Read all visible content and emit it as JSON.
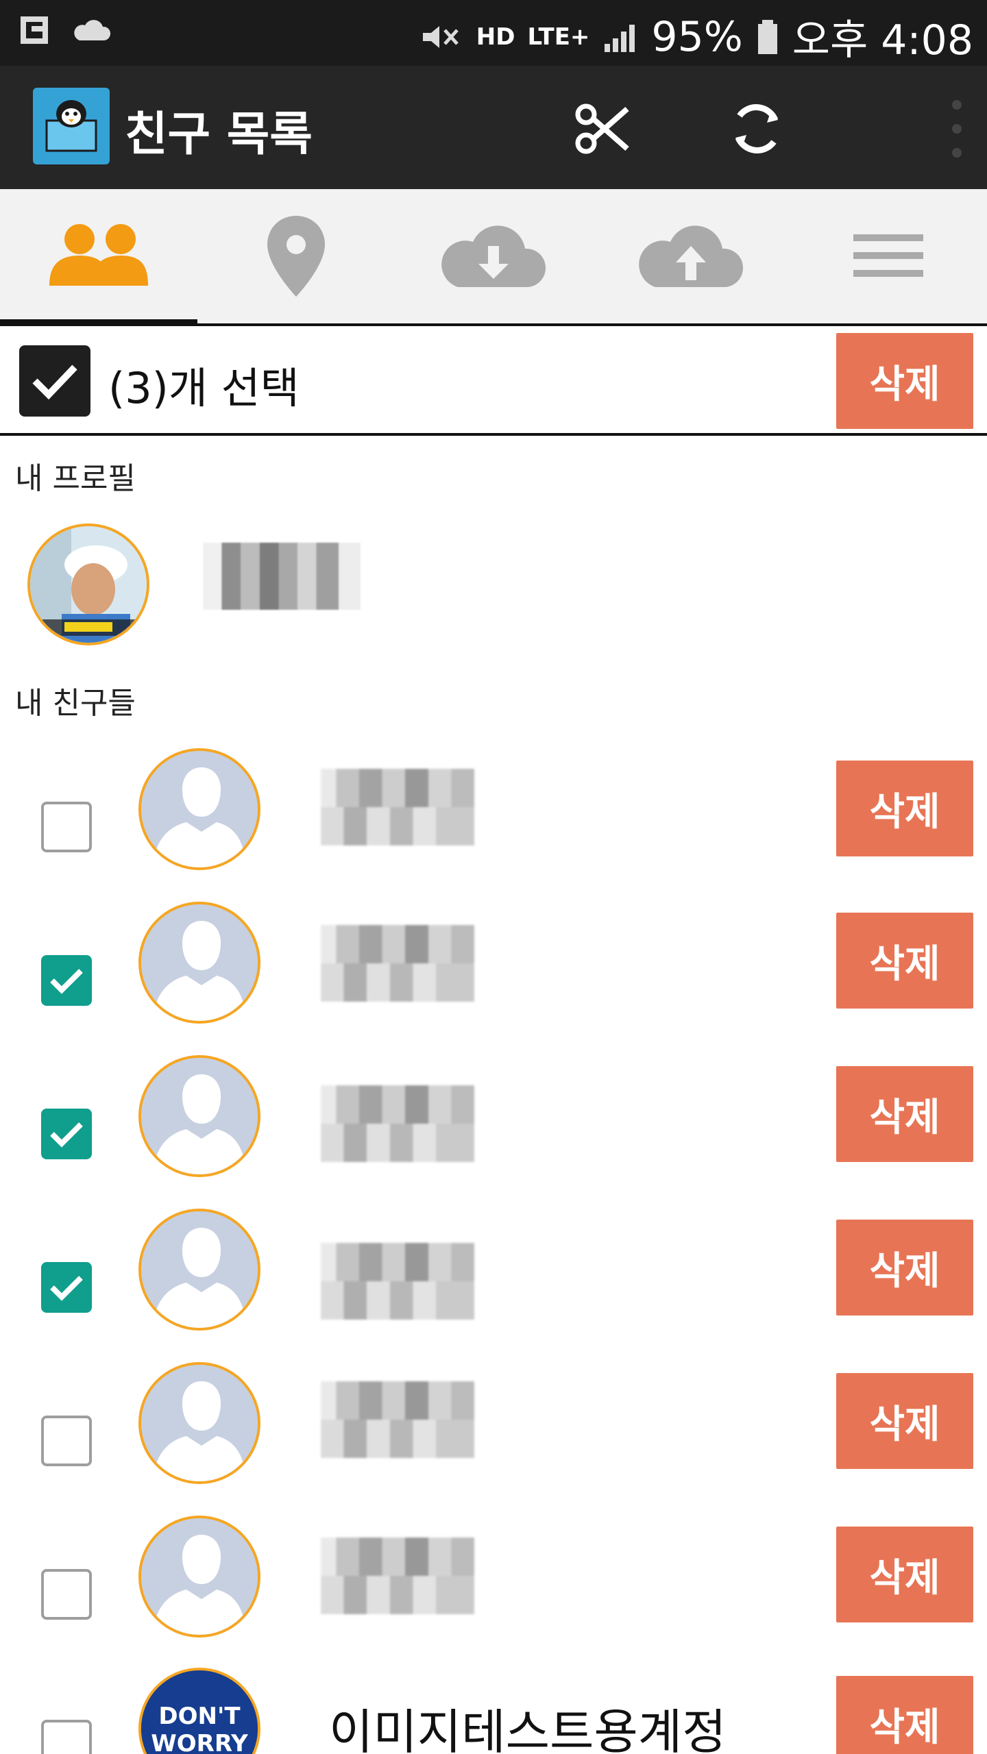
{
  "status_bar": {
    "network": "LTE+",
    "hd": "HD",
    "battery": "95%",
    "time": "오후 4:08"
  },
  "app_bar": {
    "title": "친구 목록"
  },
  "tabs": [
    {
      "name": "friends",
      "icon": "friends-icon",
      "selected": true
    },
    {
      "name": "location",
      "icon": "location-pin-icon",
      "selected": false
    },
    {
      "name": "download",
      "icon": "cloud-download-icon",
      "selected": false
    },
    {
      "name": "upload",
      "icon": "cloud-upload-icon",
      "selected": false
    },
    {
      "name": "menu",
      "icon": "menu-icon",
      "selected": false
    }
  ],
  "selection_bar": {
    "text": "(3)개 선택",
    "delete_label": "삭제"
  },
  "sections": {
    "profile_label": "내 프로필",
    "friends_label": "내 친구들"
  },
  "friends": [
    {
      "checked": false,
      "name": "",
      "delete_label": "삭제"
    },
    {
      "checked": true,
      "name": "",
      "delete_label": "삭제"
    },
    {
      "checked": true,
      "name": "",
      "delete_label": "삭제"
    },
    {
      "checked": true,
      "name": "",
      "delete_label": "삭제"
    },
    {
      "checked": false,
      "name": "",
      "delete_label": "삭제"
    },
    {
      "checked": false,
      "name": "",
      "delete_label": "삭제"
    },
    {
      "checked": false,
      "name": "이미지테스트용계정",
      "delete_label": "삭제"
    }
  ],
  "avatar_badge": {
    "line1": "DON'T",
    "line2": "WORRY"
  },
  "colors": {
    "accent_orange": "#f5a623",
    "delete_red": "#e77555",
    "checkbox_green": "#109e8d"
  }
}
